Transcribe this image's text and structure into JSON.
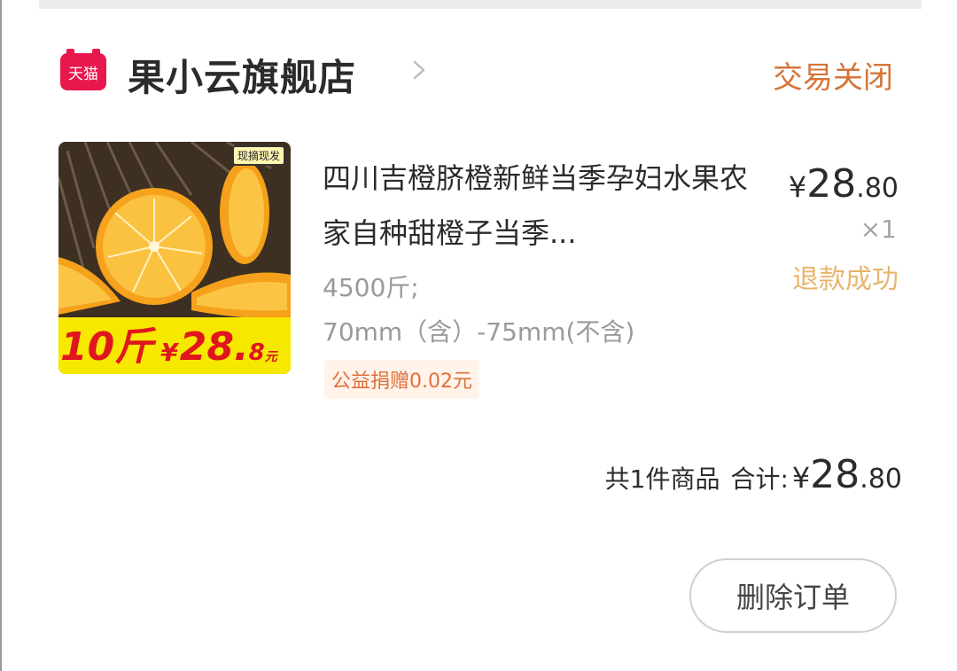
{
  "header": {
    "logo_text": "天猫",
    "shop_name": "果小云旗舰店",
    "status": "交易关闭"
  },
  "product": {
    "image_caption_big": "10斤",
    "image_caption_currency": "¥",
    "image_caption_price": "28.",
    "image_caption_decimal": "8",
    "image_caption_unit": "元",
    "image_tag": "现摘现发",
    "title": "四川吉橙脐橙新鲜当季孕妇水果农家自种甜橙子当季...",
    "sku_line1": "4500斤;",
    "sku_line2": "70mm（含）-75mm(不含)",
    "charity": "公益捐赠0.02元",
    "price_symbol": "¥",
    "price_integer": "28",
    "price_decimal": ".80",
    "quantity": "×1",
    "refund_status": "退款成功"
  },
  "summary": {
    "item_count": "共1件商品",
    "total_label": "合计:",
    "total_symbol": "¥",
    "total_integer": "28",
    "total_decimal": ".80"
  },
  "actions": {
    "delete_label": "删除订单"
  },
  "colors": {
    "tmall_red": "#e8174c",
    "status_orange": "#d4753a",
    "refund_gold": "#e8b56c",
    "charity_orange": "#e0703c"
  },
  "icons": [
    "tmall-logo-icon",
    "chevron-right-icon"
  ]
}
